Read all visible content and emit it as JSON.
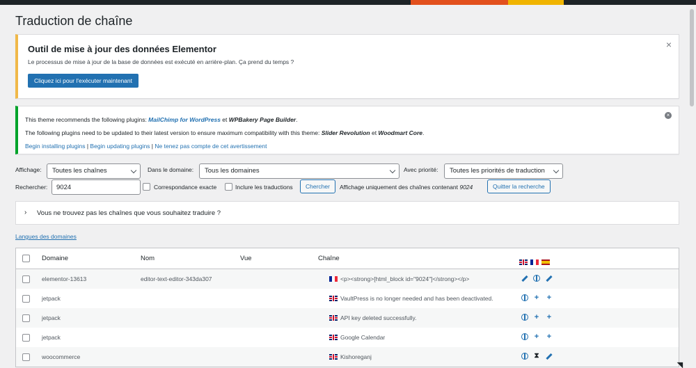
{
  "page": {
    "title": "Traduction de chaîne"
  },
  "elementor_notice": {
    "title": "Outil de mise à jour des données Elementor",
    "text": "Le processus de mise à jour de la base de données est exécuté en arrière-plan. Ça prend du temps ?",
    "button": "Cliquez ici pour l'exécuter maintenant",
    "close": "×"
  },
  "plugins_notice": {
    "l1_prefix": "This theme recommends the following plugins: ",
    "l1_plugin1": "MailChimp for WordPress",
    "l1_mid": " et ",
    "l1_plugin2": "WPBakery Page Builder",
    "l1_suffix": ".",
    "l2_prefix": "The following plugins need to be updated to their latest version to ensure maximum compatibility with this theme: ",
    "l2_plugin1": "Slider Revolution",
    "l2_mid": " et ",
    "l2_plugin2": "Woodmart Core",
    "l2_suffix": ".",
    "link_install": "Begin installing plugins",
    "sep1": " | ",
    "link_update": "Begin updating plugins",
    "sep2": " | ",
    "link_dismiss": "Ne tenez pas compte de cet avertissement",
    "close": "×"
  },
  "filters": {
    "display_label": "Affichage:",
    "display_value": "Toutes les chaînes",
    "domain_label": "Dans le domaine:",
    "domain_value": "Tous les domaines",
    "priority_label": "Avec priorité:",
    "priority_value": "Toutes les priorités de traduction",
    "search_label": "Rechercher:",
    "search_value": "9024",
    "exact_label": "Correspondance exacte",
    "include_label": "Inclure les traductions",
    "search_button": "Chercher",
    "showing_text": "Affichage uniquement des chaînes contenant ",
    "showing_term": "9024",
    "quit_button": "Quitter la recherche"
  },
  "accordion": {
    "arrow": "›",
    "text": "Vous ne trouvez pas les chaînes que vous souhaitez traduire ?"
  },
  "domains_link": "Langues des domaines",
  "table": {
    "headers": {
      "domain": "Domaine",
      "name": "Nom",
      "view": "Vue",
      "string": "Chaîne"
    },
    "header_flags": [
      "gb-flag",
      "fr-flag",
      "es-flag"
    ],
    "rows": [
      {
        "domain": "elementor-13613",
        "name": "editor-text-editor-343da307",
        "view": "",
        "flag": "fr-flag",
        "string": "<p><strong>[html_block id=\"9024\"]</strong></p>",
        "actions": [
          "pencil-icon",
          "globe-icon",
          "pencil-icon"
        ]
      },
      {
        "domain": "jetpack",
        "name": "",
        "view": "",
        "flag": "gb-flag",
        "string": "VaultPress is no longer needed and has been deactivated.",
        "actions": [
          "globe-icon",
          "plus-icon",
          "plus-icon"
        ]
      },
      {
        "domain": "jetpack",
        "name": "",
        "view": "",
        "flag": "gb-flag",
        "string": "API key deleted successfully.",
        "actions": [
          "globe-icon",
          "plus-icon",
          "plus-icon"
        ]
      },
      {
        "domain": "jetpack",
        "name": "",
        "view": "",
        "flag": "gb-flag",
        "string": "Google Calendar",
        "actions": [
          "globe-icon",
          "plus-icon",
          "plus-icon"
        ]
      },
      {
        "domain": "woocommerce",
        "name": "",
        "view": "",
        "flag": "gb-flag",
        "string": "Kishoreganj",
        "actions": [
          "globe-icon",
          "hourglass-icon",
          "pencil-icon"
        ]
      }
    ]
  },
  "colors": {
    "accent": "#2271b1",
    "warning_border": "#f0b849",
    "success_border": "#00a32a"
  }
}
